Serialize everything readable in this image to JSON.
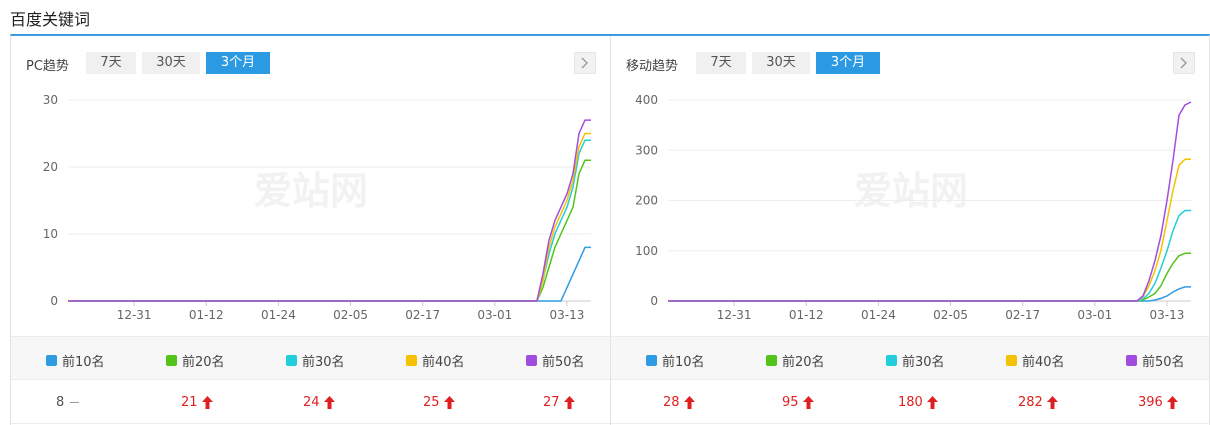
{
  "page": {
    "title": "百度关键词"
  },
  "colors": {
    "accent": "#2b9ae2",
    "up": "#e02020",
    "series": [
      "#2e9be2",
      "#52c41a",
      "#22cddc",
      "#f5c200",
      "#a04de0"
    ]
  },
  "legend": [
    "前10名",
    "前20名",
    "前30名",
    "前40名",
    "前50名"
  ],
  "panels": [
    {
      "label": "PC趋势",
      "tabs": [
        "7天",
        "30天",
        "3个月"
      ],
      "active_tab": 2,
      "values": [
        {
          "text": "8",
          "trend": "flat"
        },
        {
          "text": "21",
          "trend": "up"
        },
        {
          "text": "24",
          "trend": "up"
        },
        {
          "text": "25",
          "trend": "up"
        },
        {
          "text": "27",
          "trend": "up"
        }
      ]
    },
    {
      "label": "移动趋势",
      "tabs": [
        "7天",
        "30天",
        "3个月"
      ],
      "active_tab": 2,
      "values": [
        {
          "text": "28",
          "trend": "up"
        },
        {
          "text": "95",
          "trend": "up"
        },
        {
          "text": "180",
          "trend": "up"
        },
        {
          "text": "282",
          "trend": "up"
        },
        {
          "text": "396",
          "trend": "up"
        }
      ]
    }
  ],
  "chart_data": [
    {
      "type": "line",
      "title": "PC趋势",
      "x_ticks": [
        "12-31",
        "01-12",
        "01-24",
        "02-05",
        "02-17",
        "03-01",
        "03-13"
      ],
      "y_ticks": [
        0,
        10,
        20,
        30
      ],
      "ylim": [
        0,
        30
      ],
      "x": [
        "12-20",
        "03-08",
        "03-09",
        "03-10",
        "03-11",
        "03-12",
        "03-13",
        "03-14",
        "03-15",
        "03-16",
        "03-17"
      ],
      "grid": true,
      "series": [
        {
          "name": "前10名",
          "values": [
            0,
            0,
            0,
            0,
            0,
            0,
            2,
            4,
            6,
            8,
            8
          ]
        },
        {
          "name": "前20名",
          "values": [
            0,
            0,
            2,
            5,
            8,
            10,
            12,
            14,
            19,
            21,
            21
          ]
        },
        {
          "name": "前30名",
          "values": [
            0,
            0,
            3,
            7,
            10,
            12,
            14,
            17,
            22,
            24,
            24
          ]
        },
        {
          "name": "前40名",
          "values": [
            0,
            0,
            3,
            8,
            11,
            13,
            15,
            18,
            23,
            25,
            25
          ]
        },
        {
          "name": "前50名",
          "values": [
            0,
            0,
            4,
            9,
            12,
            14,
            16,
            19,
            25,
            27,
            27
          ]
        }
      ]
    },
    {
      "type": "line",
      "title": "移动趋势",
      "x_ticks": [
        "12-31",
        "01-12",
        "01-24",
        "02-05",
        "02-17",
        "03-01",
        "03-13"
      ],
      "y_ticks": [
        0,
        100,
        200,
        300,
        400
      ],
      "ylim": [
        0,
        400
      ],
      "x": [
        "12-20",
        "03-08",
        "03-09",
        "03-10",
        "03-11",
        "03-12",
        "03-13",
        "03-14",
        "03-15",
        "03-16",
        "03-17"
      ],
      "grid": true,
      "series": [
        {
          "name": "前10名",
          "values": [
            0,
            0,
            0,
            0,
            2,
            5,
            10,
            18,
            24,
            28,
            28
          ]
        },
        {
          "name": "前20名",
          "values": [
            0,
            0,
            2,
            8,
            15,
            30,
            55,
            75,
            90,
            95,
            95
          ]
        },
        {
          "name": "前30名",
          "values": [
            0,
            0,
            4,
            15,
            35,
            65,
            100,
            140,
            170,
            180,
            180
          ]
        },
        {
          "name": "前40名",
          "values": [
            0,
            0,
            8,
            30,
            60,
            100,
            160,
            220,
            270,
            282,
            282
          ]
        },
        {
          "name": "前50名",
          "values": [
            0,
            0,
            10,
            40,
            80,
            130,
            200,
            280,
            370,
            390,
            396
          ]
        }
      ]
    }
  ]
}
